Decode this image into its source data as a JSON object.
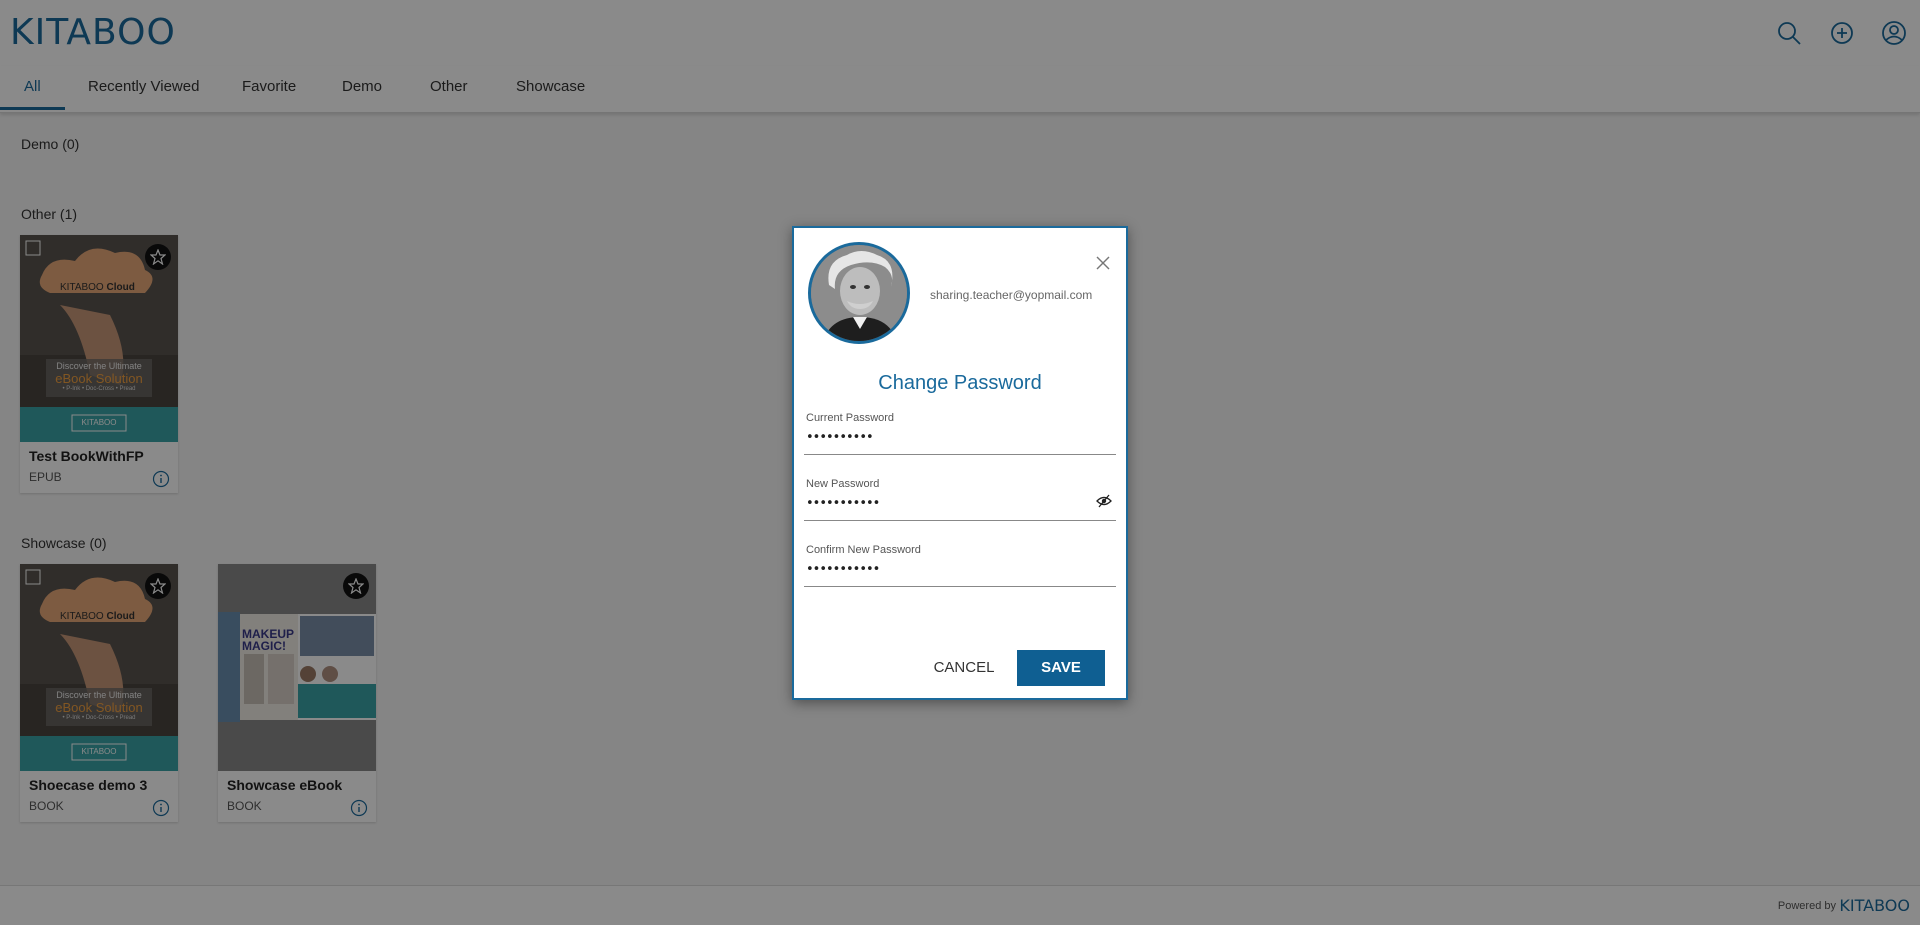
{
  "app": {
    "logo": "KITABOO"
  },
  "header": {
    "icons": [
      "search-icon",
      "add-circle-icon",
      "account-icon"
    ]
  },
  "tabs": [
    {
      "label": "All",
      "active": true
    },
    {
      "label": "Recently Viewed"
    },
    {
      "label": "Favorite"
    },
    {
      "label": "Demo"
    },
    {
      "label": "Other"
    },
    {
      "label": "Showcase"
    }
  ],
  "sections": [
    {
      "title": "Demo (0)"
    },
    {
      "title": "Other (1)"
    },
    {
      "title": "Showcase (0)"
    }
  ],
  "books": [
    {
      "title": "Test BookWithFP",
      "type": "EPUB",
      "cover": {
        "brand": "KITABOO",
        "brand_suffix": "Cloud",
        "line1": "Discover the Ultimate",
        "line2": "eBook Solution",
        "line3": "• P-Ink • Doc-Cross • Pread",
        "badge": "KITABOO"
      }
    },
    {
      "title": "Shoecase demo 3",
      "type": "BOOK",
      "cover": {
        "brand": "KITABOO",
        "brand_suffix": "Cloud",
        "line1": "Discover the Ultimate",
        "line2": "eBook Solution",
        "line3": "• P-Ink • Doc-Cross • Pread",
        "badge": "KITABOO"
      }
    },
    {
      "title": "Showcase eBook",
      "type": "BOOK",
      "cover": {
        "headline": "MAKEUP MAGIC!"
      }
    }
  ],
  "footer": {
    "powered_by": "Powered by",
    "logo": "KITABOO"
  },
  "dialog": {
    "email": "sharing.teacher@yopmail.com",
    "title": "Change Password",
    "fields": [
      {
        "label": "Current Password",
        "value": "••••••••••"
      },
      {
        "label": "New Password",
        "value": "•••••••••••"
      },
      {
        "label": "Confirm New Password",
        "value": "•••••••••••"
      }
    ],
    "cancel_label": "CANCEL",
    "save_label": "SAVE"
  },
  "colors": {
    "accent": "#1a6a9c",
    "save_button": "#0f5f92",
    "cover_teal": "#3aa3a6"
  }
}
